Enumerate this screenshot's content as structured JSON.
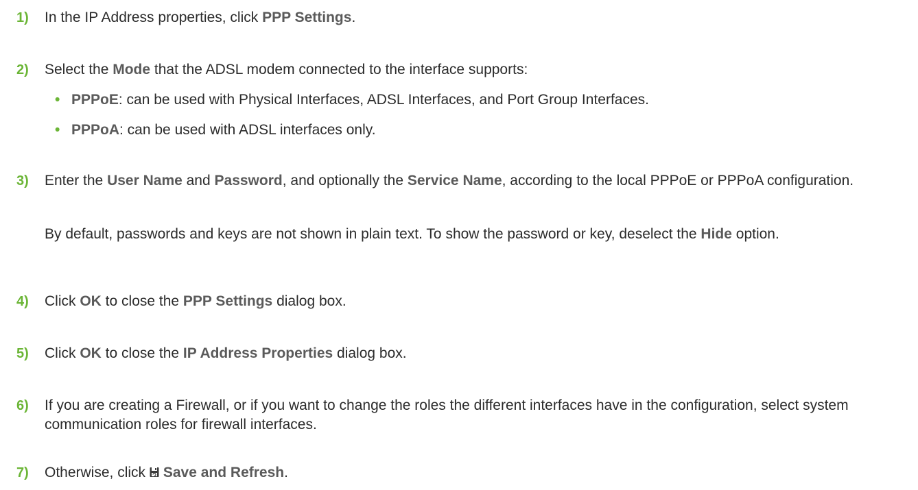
{
  "steps": [
    {
      "num": "1)",
      "pre": "In the IP Address properties, click ",
      "b1": "PPP Settings",
      "post": "."
    },
    {
      "num": "2)",
      "pre": "Select the ",
      "b1": "Mode",
      "post": " that the ADSL modem connected to the interface supports:",
      "bullets": [
        {
          "term": "PPPoE",
          "text": ": can be used with Physical Interfaces, ADSL Interfaces, and Port Group Interfaces."
        },
        {
          "term": "PPPoA",
          "text": ": can be used with ADSL interfaces only."
        }
      ]
    },
    {
      "num": "3)",
      "t1": "Enter the ",
      "b1": "User Name",
      "t2": " and ",
      "b2": "Password",
      "t3": ", and optionally the ",
      "b3": "Service Name",
      "t4": ", according to the local PPPoE or PPPoA configuration.",
      "note_pre": "By default, passwords and keys are not shown in plain text. To show the password or key, deselect the ",
      "note_b": "Hide",
      "note_post": " option."
    },
    {
      "num": "4)",
      "t1": "Click ",
      "b1": "OK",
      "t2": " to close the ",
      "b2": "PPP Settings",
      "t3": " dialog box."
    },
    {
      "num": "5)",
      "t1": "Click ",
      "b1": "OK",
      "t2": " to close the ",
      "b2": "IP Address Properties",
      "t3": " dialog box."
    },
    {
      "num": "6)",
      "text": "If you are creating a Firewall, or if you want to change the roles the different interfaces have in the configuration, select system communication roles for firewall interfaces."
    },
    {
      "num": "7)",
      "pre": "Otherwise, click ",
      "icon": "save-and-refresh-icon",
      "b1": "Save and Refresh",
      "post": "."
    }
  ],
  "colors": {
    "step_number": "#6bb536",
    "text": "#2b2b2b",
    "bold_term": "#5a5a5a"
  }
}
